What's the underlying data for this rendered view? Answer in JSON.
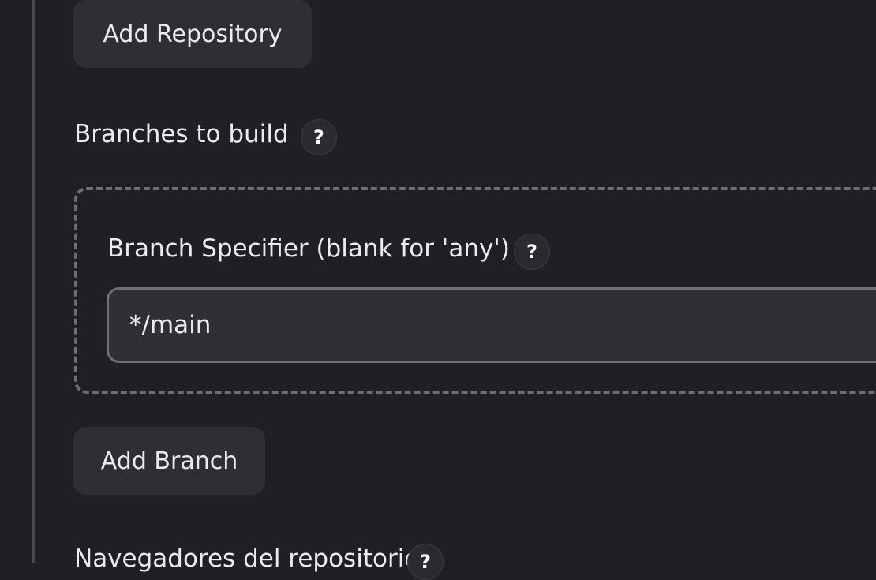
{
  "scm": {
    "add_repository_label": "Add Repository",
    "branches_label": "Branches to build",
    "branch_specifier": {
      "label": "Branch Specifier (blank for 'any')",
      "value": "*/main"
    },
    "add_branch_label": "Add Branch",
    "repo_browser_label": "Navegadores del repositorio",
    "help_glyph": "?"
  }
}
